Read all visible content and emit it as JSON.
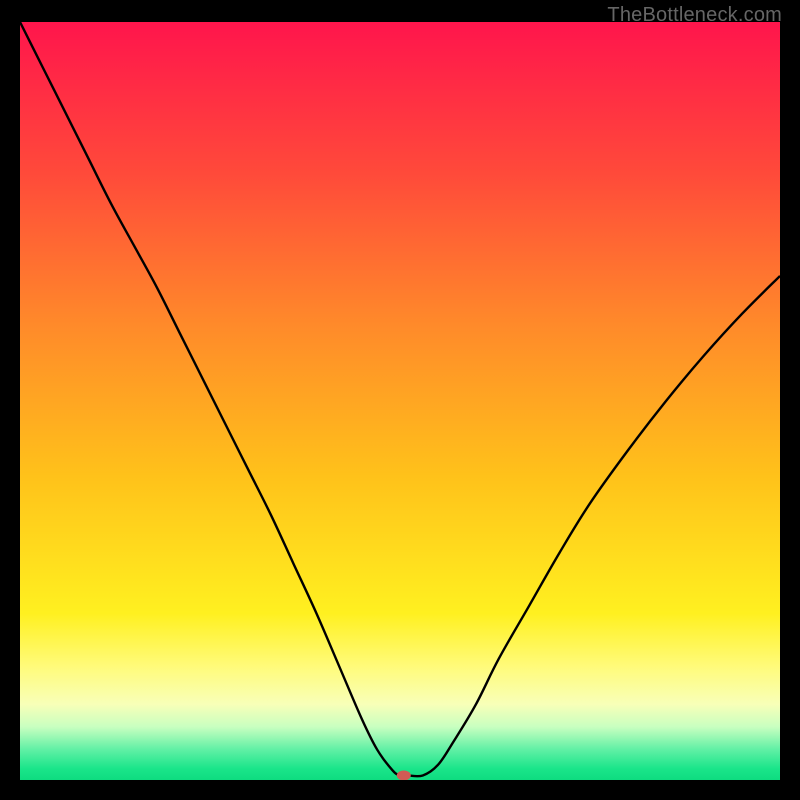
{
  "watermark": "TheBottleneck.com",
  "chart_data": {
    "type": "line",
    "title": "",
    "xlabel": "",
    "ylabel": "",
    "xlim": [
      0,
      100
    ],
    "ylim": [
      0,
      100
    ],
    "grid": false,
    "legend": false,
    "background_gradient": {
      "stops": [
        {
          "offset": 0.0,
          "color": "#ff154c"
        },
        {
          "offset": 0.2,
          "color": "#ff4a3a"
        },
        {
          "offset": 0.4,
          "color": "#ff8a2a"
        },
        {
          "offset": 0.6,
          "color": "#ffc21a"
        },
        {
          "offset": 0.78,
          "color": "#fff020"
        },
        {
          "offset": 0.85,
          "color": "#fffb7a"
        },
        {
          "offset": 0.9,
          "color": "#f8ffb8"
        },
        {
          "offset": 0.93,
          "color": "#c8ffc0"
        },
        {
          "offset": 0.96,
          "color": "#60f0a5"
        },
        {
          "offset": 0.985,
          "color": "#1ae58a"
        },
        {
          "offset": 1.0,
          "color": "#0edc80"
        }
      ]
    },
    "series": [
      {
        "name": "bottleneck-curve",
        "color": "#000000",
        "x": [
          0.0,
          3,
          6,
          9,
          12,
          15,
          18,
          21,
          24,
          27,
          30,
          33,
          36,
          39,
          42,
          45,
          47,
          49,
          50,
          51,
          53,
          55,
          57,
          60,
          63,
          67,
          71,
          75,
          80,
          85,
          90,
          95,
          100
        ],
        "y": [
          100,
          94,
          88,
          82,
          76,
          70.5,
          65,
          59,
          53,
          47,
          41,
          35,
          28.5,
          22,
          15,
          8,
          4,
          1.3,
          0.6,
          0.6,
          0.6,
          2,
          5,
          10,
          16,
          23,
          30,
          36.5,
          43.5,
          50,
          56,
          61.5,
          66.5
        ]
      }
    ],
    "marker": {
      "name": "optimal-point",
      "x": 50.5,
      "y": 0.6,
      "color": "#d15a54",
      "rx": 7,
      "ry": 5
    }
  }
}
